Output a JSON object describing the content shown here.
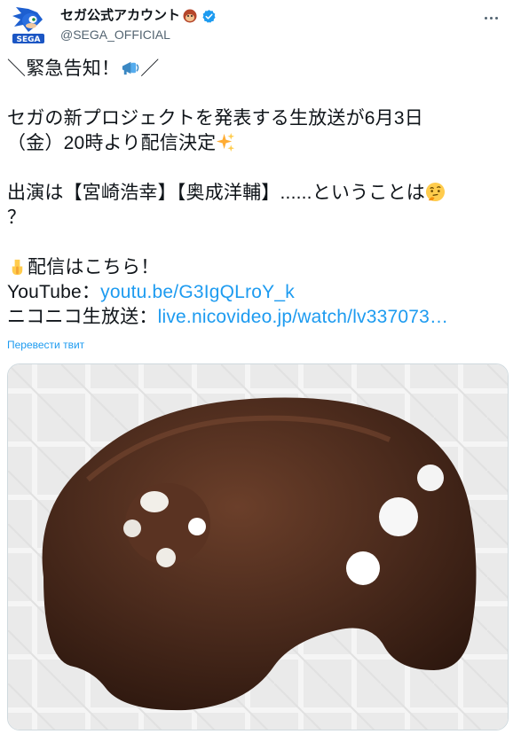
{
  "author": {
    "name": "セガ公式アカウント",
    "handle": "@SEGA_OFFICIAL",
    "avatar_icon": "sonic-sega-avatar",
    "badge_icon": "sonic-face-emoji",
    "verified_icon": "verified-badge-icon"
  },
  "tweet": {
    "line1": "＼緊急告知！",
    "line1_end": "／",
    "line2": "セガの新プロジェクトを発表する生放送が6月3日",
    "line3": "（金）20時より配信決定",
    "line4": "出演は【宮崎浩幸】【奥成洋輔】......ということは",
    "line5": "？",
    "line6": "配信はこちら！",
    "youtube_label": "YouTube：",
    "youtube_link": "youtu.be/G3IgQLroY_k",
    "nico_label": "ニコニコ生放送：",
    "nico_link": "live.nicovideo.jp/watch/lv337073…"
  },
  "translate_label": "Перевести твит",
  "colors": {
    "link": "#1d9bf0",
    "chocolate": "#4a2a1c",
    "verified": "#1d9bf0"
  }
}
